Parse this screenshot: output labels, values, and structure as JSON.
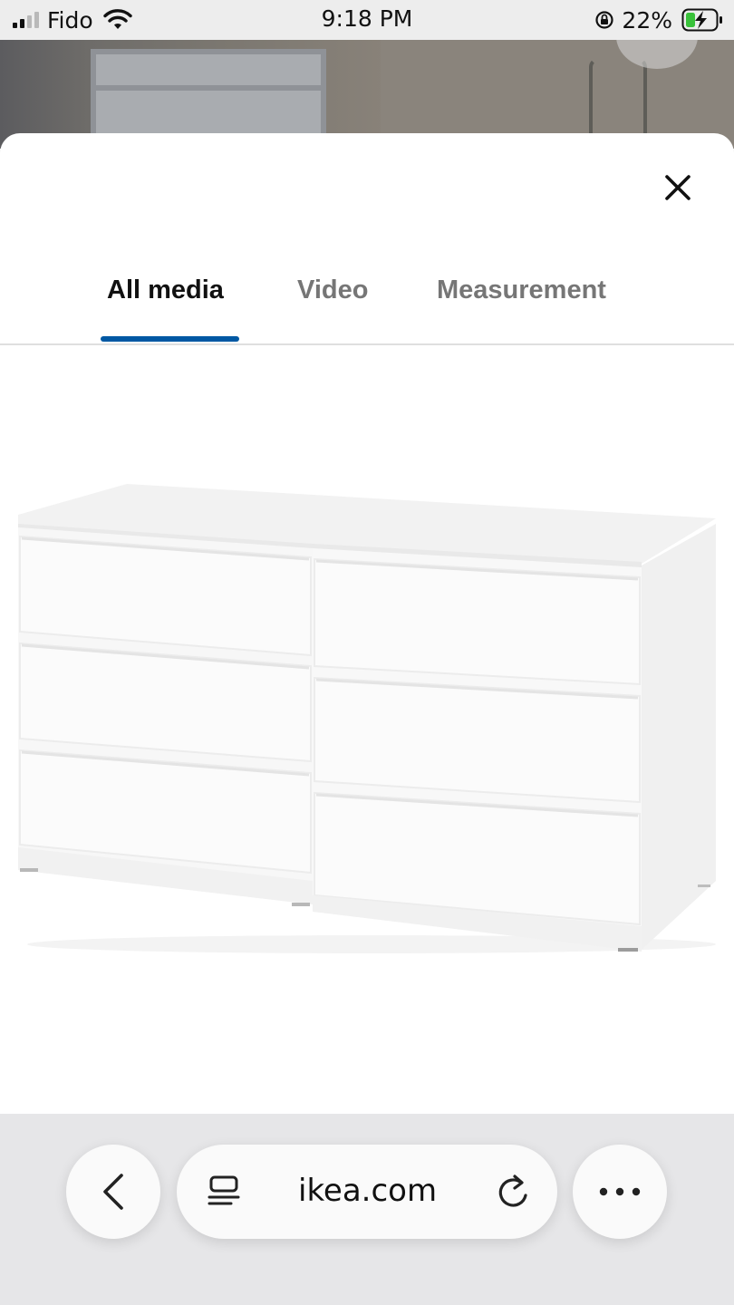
{
  "status_bar": {
    "carrier": "Fido",
    "time": "9:18 PM",
    "battery_percent": "22%",
    "icons": [
      "signal-icon",
      "wifi-icon",
      "rotation-lock-icon",
      "battery-charging-icon"
    ]
  },
  "media_viewer": {
    "close_icon": "close-icon",
    "tabs": [
      {
        "label": "All media",
        "selected": true
      },
      {
        "label": "Video",
        "selected": false
      },
      {
        "label": "Measurement",
        "selected": false
      }
    ],
    "accent_color": "#0058a3",
    "image": "white 6-drawer dresser"
  },
  "browser": {
    "url": "ikea.com",
    "icons": [
      "back-icon",
      "reader-icon",
      "reload-icon",
      "more-icon"
    ]
  }
}
